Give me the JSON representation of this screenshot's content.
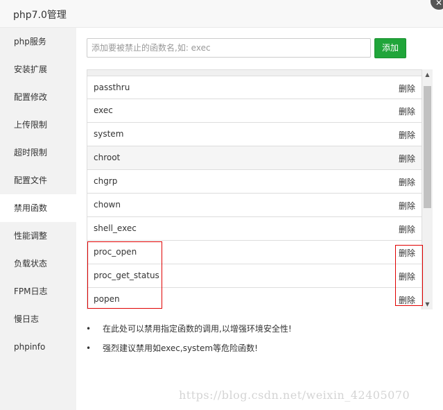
{
  "window": {
    "title": "php7.0管理",
    "close_icon": "close-icon"
  },
  "sidebar": {
    "items": [
      {
        "label": "php服务"
      },
      {
        "label": "安装扩展"
      },
      {
        "label": "配置修改"
      },
      {
        "label": "上传限制"
      },
      {
        "label": "超时限制"
      },
      {
        "label": "配置文件"
      },
      {
        "label": "禁用函数"
      },
      {
        "label": "性能调整"
      },
      {
        "label": "负载状态"
      },
      {
        "label": "FPM日志"
      },
      {
        "label": "慢日志"
      },
      {
        "label": "phpinfo"
      }
    ],
    "active": "禁用函数"
  },
  "toolbar": {
    "input_placeholder": "添加要被禁止的函数名,如: exec",
    "input_value": "",
    "add_label": "添加",
    "accent_color": "#20a53a"
  },
  "functions": {
    "rows": [
      {
        "name": "passthru",
        "action": "删除"
      },
      {
        "name": "exec",
        "action": "删除"
      },
      {
        "name": "system",
        "action": "删除"
      },
      {
        "name": "chroot",
        "action": "删除"
      },
      {
        "name": "chgrp",
        "action": "删除"
      },
      {
        "name": "chown",
        "action": "删除"
      },
      {
        "name": "shell_exec",
        "action": "删除"
      },
      {
        "name": "proc_open",
        "action": "删除"
      },
      {
        "name": "proc_get_status",
        "action": "删除"
      },
      {
        "name": "popen",
        "action": "删除"
      }
    ],
    "highlight_color": "#e00000"
  },
  "notes": [
    "在此处可以禁用指定函数的调用,以增强环境安全性!",
    "强烈建议禁用如exec,system等危险函数!"
  ],
  "watermark": "https://blog.csdn.net/weixin_42405070"
}
